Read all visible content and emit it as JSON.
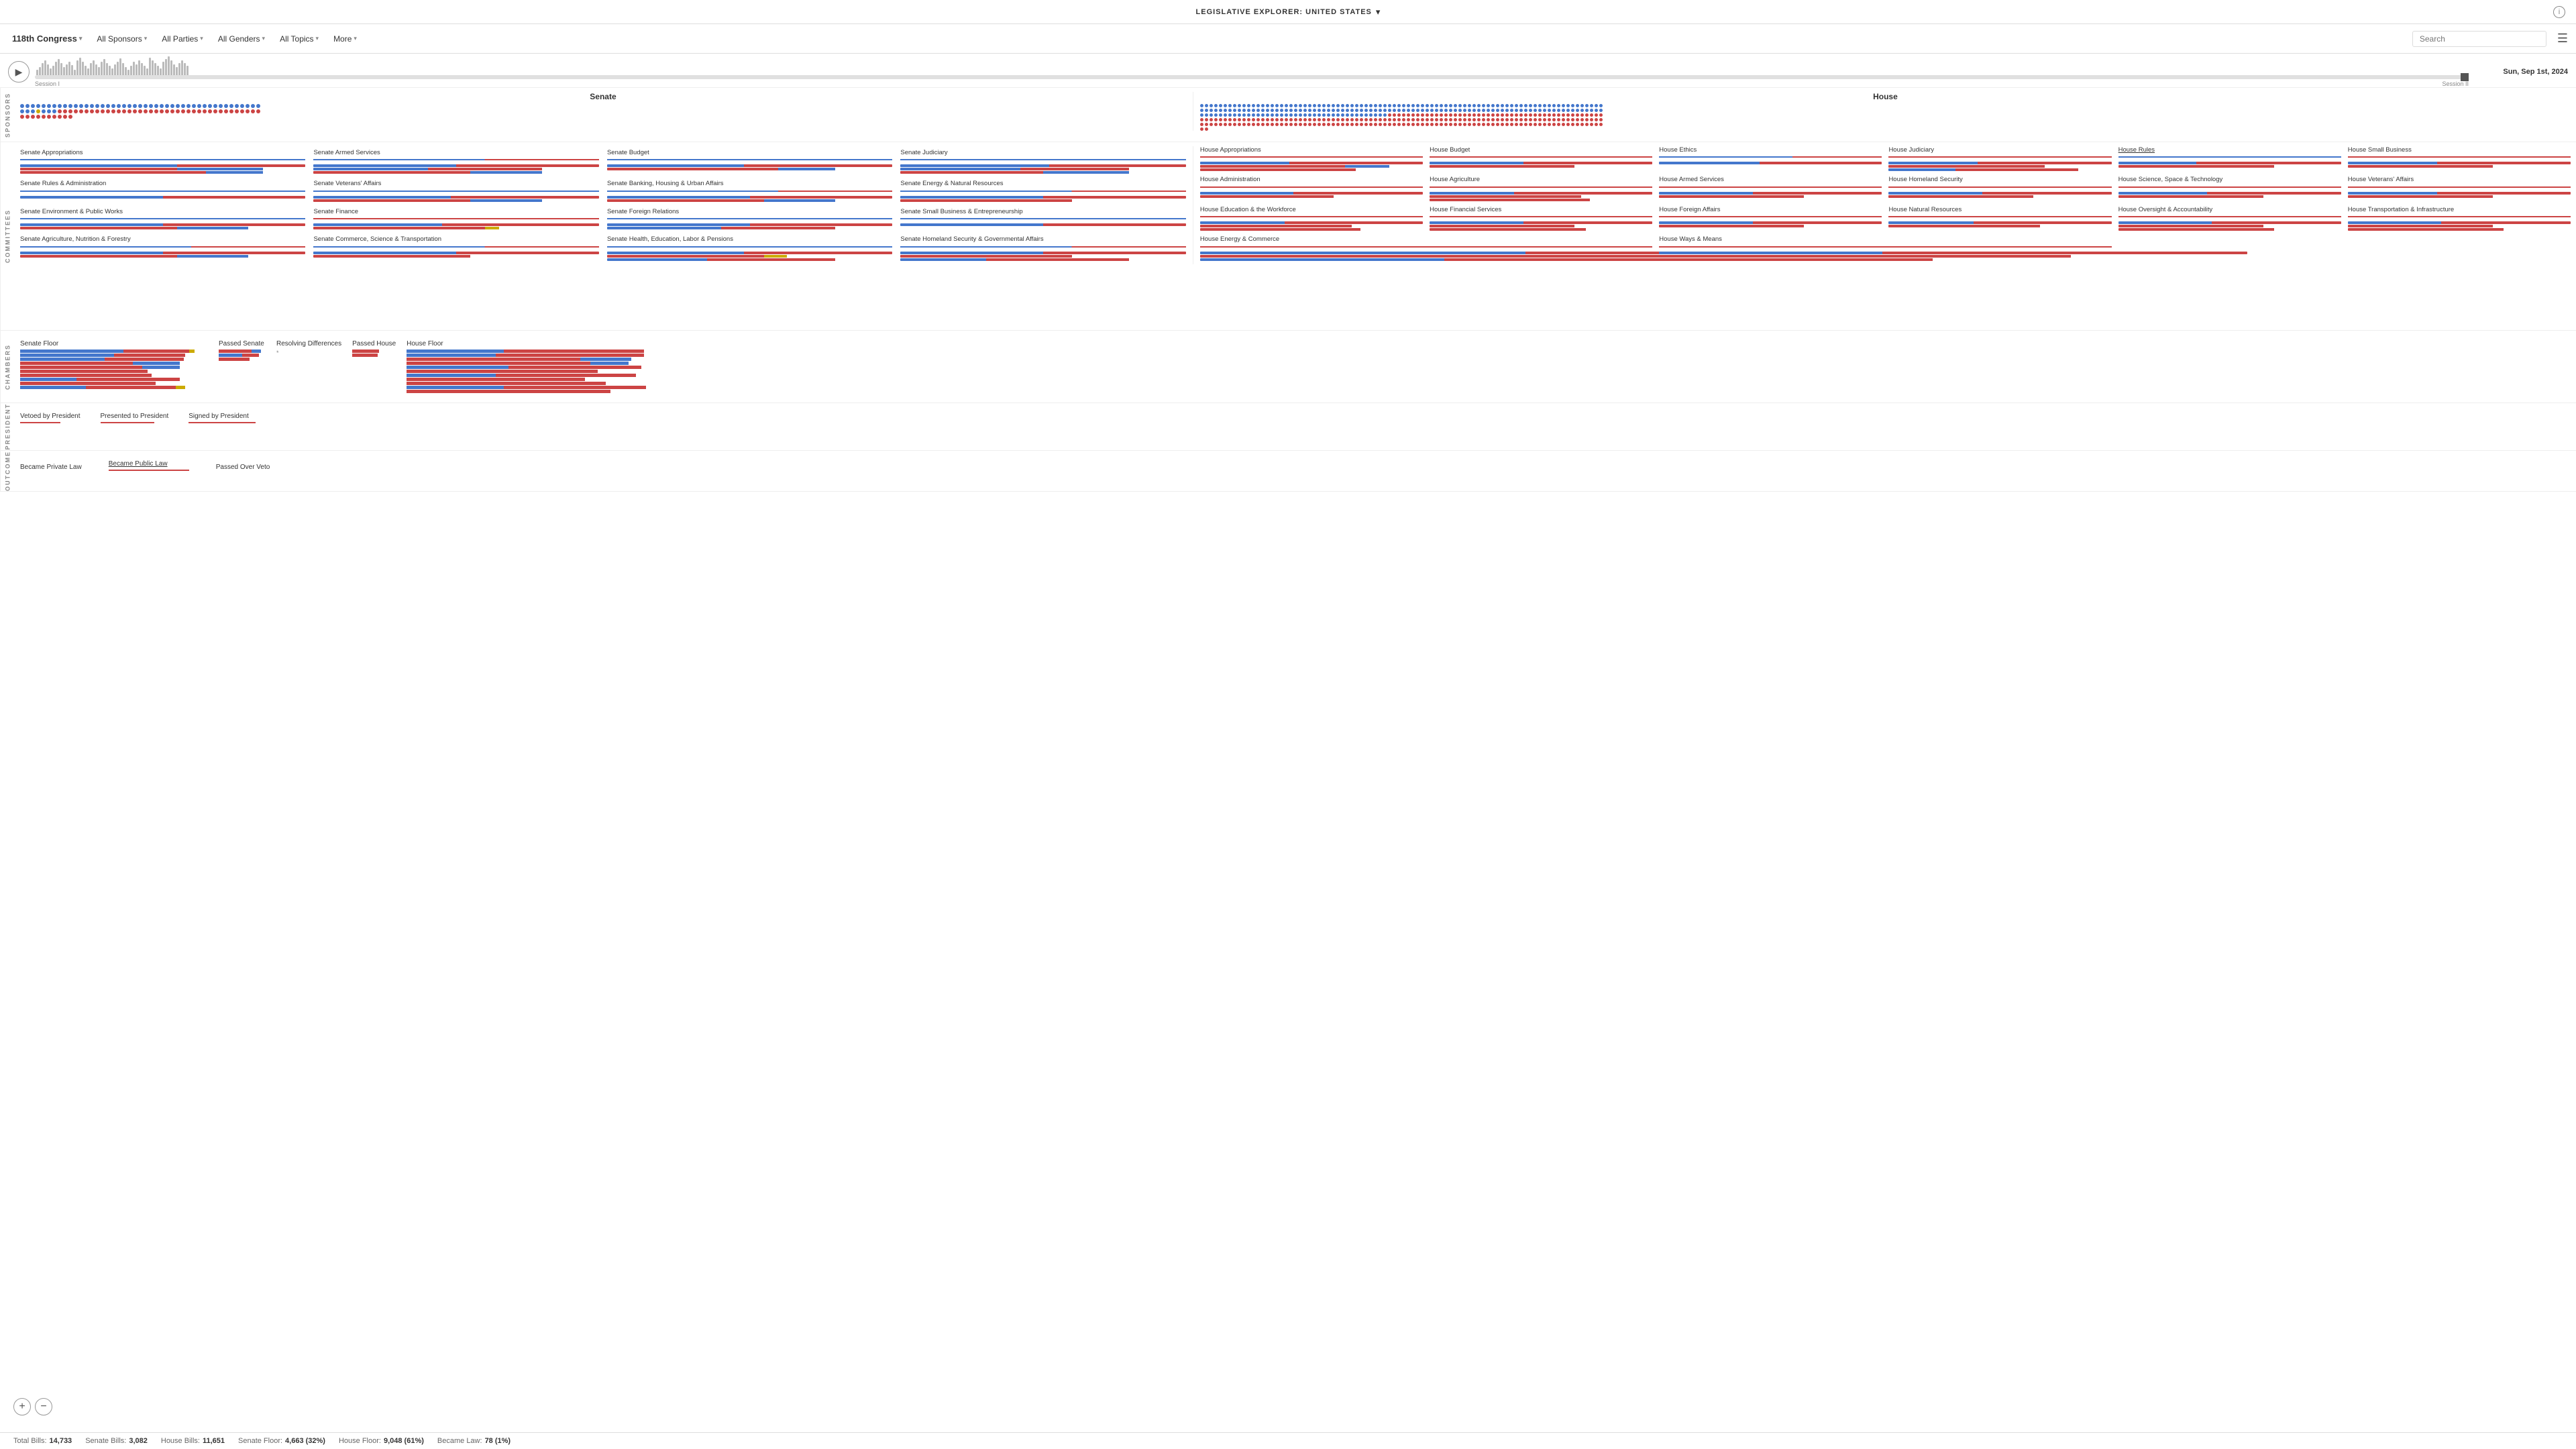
{
  "topbar": {
    "title": "LEGISLATIVE EXPLORER: UNITED STATES",
    "caret": "▾",
    "info": "ⓘ"
  },
  "filters": {
    "congress": "118th Congress",
    "sponsors": "All Sponsors",
    "parties": "All Parties",
    "genders": "All Genders",
    "topics": "All Topics",
    "more": "More",
    "search_placeholder": "Search"
  },
  "date": "Sun, Sep 1st, 2024",
  "sessions": {
    "session1": "Session I",
    "session2": "Session II"
  },
  "chambers": {
    "senate": "Senate",
    "house": "House"
  },
  "senate_committees": [
    {
      "name": "Senate Appropriations",
      "blue_pct": 0.55,
      "red_pct": 0.45
    },
    {
      "name": "Senate Armed Services",
      "blue_pct": 0.5,
      "red_pct": 0.5
    },
    {
      "name": "Senate Budget",
      "blue_pct": 0.48,
      "red_pct": 0.52
    },
    {
      "name": "Senate Judiciary",
      "blue_pct": 0.52,
      "red_pct": 0.48
    },
    {
      "name": "Senate Rules & Administration",
      "blue_pct": 0.5,
      "red_pct": 0.5
    },
    {
      "name": "Senate Veterans' Affairs",
      "blue_pct": 0.48,
      "red_pct": 0.52
    },
    {
      "name": "Senate Banking, Housing & Urban Affairs",
      "blue_pct": 0.5,
      "red_pct": 0.5
    },
    {
      "name": "Senate Energy & Natural Resources",
      "blue_pct": 0.5,
      "red_pct": 0.5
    },
    {
      "name": "Senate Environment & Public Works",
      "blue_pct": 0.5,
      "red_pct": 0.5
    },
    {
      "name": "Senate Finance",
      "blue_pct": 0.45,
      "red_pct": 0.55
    },
    {
      "name": "Senate Foreign Relations",
      "blue_pct": 0.5,
      "red_pct": 0.5
    },
    {
      "name": "Senate Small Business & Entrepreneurship",
      "blue_pct": 0.5,
      "red_pct": 0.5
    },
    {
      "name": "Senate Agriculture, Nutrition & Forestry",
      "blue_pct": 0.5,
      "red_pct": 0.5
    },
    {
      "name": "Senate Commerce, Science & Transportation",
      "blue_pct": 0.5,
      "red_pct": 0.5
    },
    {
      "name": "Senate Health, Education, Labor & Pensions",
      "blue_pct": 0.48,
      "red_pct": 0.52
    },
    {
      "name": "Senate Homeland Security & Governmental Affairs",
      "blue_pct": 0.5,
      "red_pct": 0.5
    }
  ],
  "house_committees": [
    {
      "name": "House Appropriations",
      "blue_pct": 0.45,
      "red_pct": 0.55
    },
    {
      "name": "House Budget",
      "blue_pct": 0.42,
      "red_pct": 0.58
    },
    {
      "name": "House Ethics",
      "blue_pct": 0.5,
      "red_pct": 0.5
    },
    {
      "name": "House Judiciary",
      "blue_pct": 0.42,
      "red_pct": 0.58
    },
    {
      "name": "House Rules",
      "blue_pct": 0.35,
      "red_pct": 0.65
    },
    {
      "name": "House Small Business",
      "blue_pct": 0.42,
      "red_pct": 0.58
    },
    {
      "name": "House Administration",
      "blue_pct": 0.42,
      "red_pct": 0.58
    },
    {
      "name": "House Agriculture",
      "blue_pct": 0.4,
      "red_pct": 0.6
    },
    {
      "name": "House Armed Services",
      "blue_pct": 0.42,
      "red_pct": 0.58
    },
    {
      "name": "House Homeland Security",
      "blue_pct": 0.42,
      "red_pct": 0.58
    },
    {
      "name": "House Science, Space & Technology",
      "blue_pct": 0.4,
      "red_pct": 0.6
    },
    {
      "name": "House Veterans' Affairs",
      "blue_pct": 0.4,
      "red_pct": 0.6
    },
    {
      "name": "House Education & the Workforce",
      "blue_pct": 0.4,
      "red_pct": 0.6
    },
    {
      "name": "House Financial Services",
      "blue_pct": 0.42,
      "red_pct": 0.58
    },
    {
      "name": "House Foreign Affairs",
      "blue_pct": 0.42,
      "red_pct": 0.58
    },
    {
      "name": "House Natural Resources",
      "blue_pct": 0.4,
      "red_pct": 0.6
    },
    {
      "name": "House Oversight & Accountability",
      "blue_pct": 0.42,
      "red_pct": 0.58
    },
    {
      "name": "House Transportation & Infrastructure",
      "blue_pct": 0.42,
      "red_pct": 0.58
    },
    {
      "name": "House Energy & Commerce",
      "blue_pct": 0.42,
      "red_pct": 0.58
    },
    {
      "name": "House Ways & Means",
      "blue_pct": 0.38,
      "red_pct": 0.62
    }
  ],
  "chambers_flow": {
    "senate_floor": "Senate Floor",
    "passed_senate": "Passed Senate",
    "resolving_differences": "Resolving Differences",
    "passed_house": "Passed House",
    "house_floor": "House Floor",
    "vetoed_by_president": "Vetoed by President",
    "presented_to_president": "Presented to President",
    "signed_by_president": "Signed by President",
    "became_private_law": "Became Private Law",
    "became_public_law": "Became Public Law",
    "passed_over_veto": "Passed Over Veto"
  },
  "stats": {
    "total_bills_label": "Total Bills:",
    "total_bills": "14,733",
    "senate_bills_label": "Senate Bills:",
    "senate_bills": "3,082",
    "house_bills_label": "House Bills:",
    "house_bills": "11,651",
    "senate_floor_label": "Senate Floor:",
    "senate_floor": "4,663 (32%)",
    "house_floor_label": "House Floor:",
    "house_floor": "9,048 (61%)",
    "became_law_label": "Became Law:",
    "became_law": "78 (1%)"
  },
  "colors": {
    "blue": "#4477cc",
    "red": "#cc4444",
    "yellow": "#ccaa00",
    "gray": "#cccccc"
  }
}
